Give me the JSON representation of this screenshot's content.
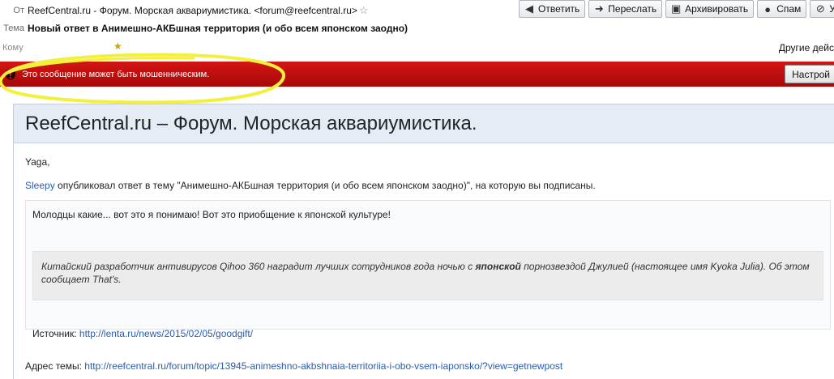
{
  "header": {
    "from_label": "От",
    "from_value": "ReefCentral.ru - Форум. Морская аквариумистика. <forum@reefcentral.ru>",
    "subject_label": "Тема",
    "subject_value": "Новый ответ в Анимешно-АКБшная территория (и обо всем японском заодно)",
    "to_label": "Кому",
    "other_actions": "Другие дейс"
  },
  "toolbar": {
    "reply": "Ответить",
    "forward": "Переслать",
    "archive": "Архивировать",
    "spam": "Спам",
    "delete": "У"
  },
  "scam_warning": {
    "text": "Это сообщение может быть мошенническим.",
    "settings_button": "Настрой"
  },
  "colors": {
    "scam_bar": "#c40f0f",
    "highlight": "#f2f03a",
    "link": "#2a5db0",
    "title_bar": "#e5ecf4"
  },
  "message": {
    "title": "ReefCentral.ru – Форум. Морская аквариумистика.",
    "greeting": "Yaga,",
    "user_link": "Sleepy",
    "notice_text": " опубликовал ответ в тему \"Анимешно-АКБшная территория (и обо всем японском заодно)\", на которую вы подписаны.",
    "quote_first_line": "Молодцы какие... вот это я понимаю! Вот это приобщение к японской культуре!",
    "quote_inner_before": "Китайский разработчик антивирусов Qihoo 360 наградит лучших сотрудников года ночью с ",
    "quote_inner_bold": "японской",
    "quote_inner_after": " порнозвездой Джулией (настоящее имя Kyoka Julia). Об этом сообщает That's.",
    "source_label": "Источник: ",
    "source_link": "http://lenta.ru/news/2015/02/05/goodgift/",
    "address_label": "Адрес темы: ",
    "address_link": "http://reefcentral.ru/forum/topic/13945-animeshno-akbshnaia-territoriia-i-obo-vsem-iaponsko/?view=getnewpost"
  }
}
